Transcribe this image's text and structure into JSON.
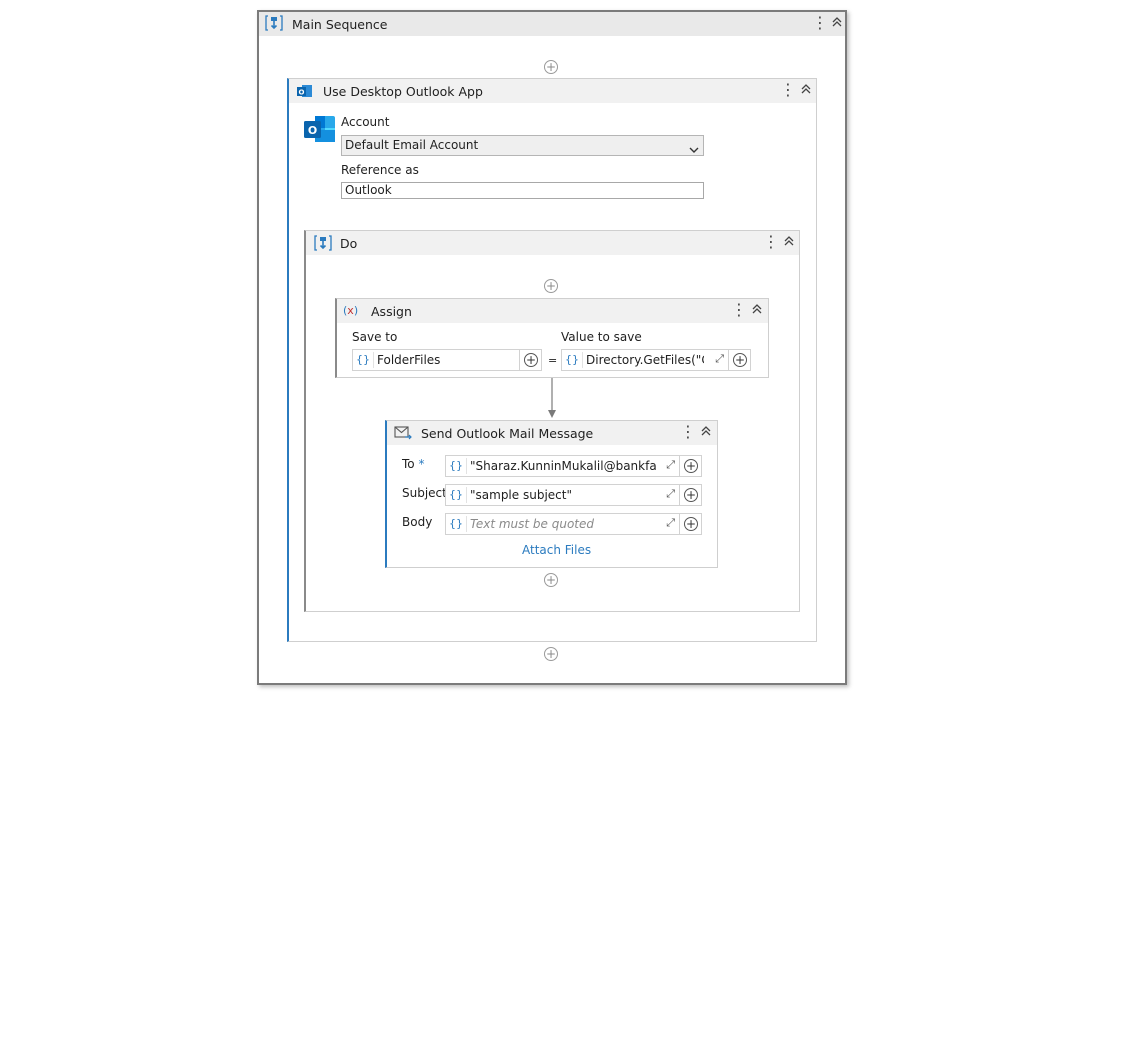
{
  "main_sequence": {
    "title": "Main Sequence",
    "icon": "sequence-icon"
  },
  "outlook_scope": {
    "title": "Use Desktop Outlook App",
    "icon": "outlook-icon",
    "account_label": "Account",
    "account_value": "Default Email Account",
    "reference_label": "Reference as",
    "reference_value": "Outlook"
  },
  "do_block": {
    "title": "Do",
    "icon": "sequence-icon"
  },
  "assign": {
    "title": "Assign",
    "icon": "assign-icon",
    "save_to_label": "Save to",
    "value_label": "Value to save",
    "save_to_value": "FolderFiles",
    "value_value": "Directory.GetFiles(\"C:\\",
    "equals": "="
  },
  "send_mail": {
    "title": "Send Outlook Mail Message",
    "icon": "mail-send-icon",
    "to_label": "To",
    "required_mark": "*",
    "to_value": "\"Sharaz.KunninMukalil@bankfab.cc",
    "subject_label": "Subject",
    "subject_value": "\"sample subject\"",
    "body_label": "Body",
    "body_placeholder": "Text must be quoted",
    "attach_label": "Attach Files"
  },
  "symbols": {
    "dots": "⋮",
    "collapse": "︽",
    "plus": "+",
    "brace": "{}",
    "expand": "⤢",
    "chevron": "⌄"
  },
  "colors": {
    "accent": "#2b7bbf",
    "outlook_blue": "#0a64ad",
    "header_bg": "#e9e9e9"
  }
}
